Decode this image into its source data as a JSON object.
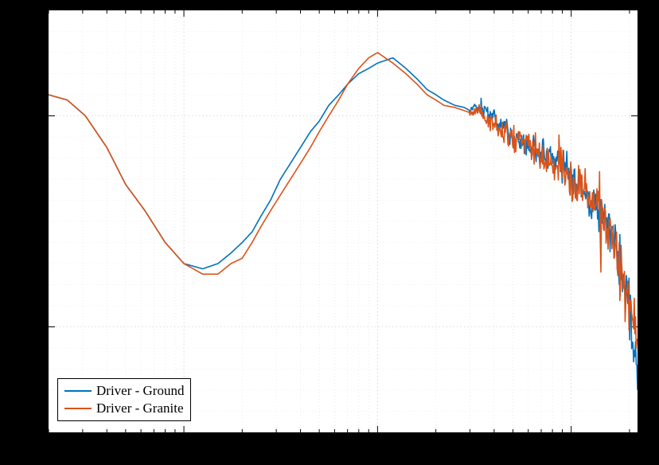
{
  "chart_data": {
    "type": "line",
    "title": "",
    "xlabel": "",
    "ylabel": "",
    "x_scale": "log",
    "x_range": [
      20,
      22000
    ],
    "y_range": [
      -30,
      10
    ],
    "major_y": [
      -20,
      0
    ],
    "series": [
      {
        "name": "Driver - Ground",
        "color": "#0072BD",
        "x": [
          20,
          25,
          31,
          40,
          50,
          63,
          80,
          100,
          125,
          150,
          175,
          200,
          225,
          250,
          280,
          315,
          355,
          400,
          450,
          500,
          560,
          630,
          700,
          800,
          900,
          1000,
          1200,
          1400,
          1600,
          1800,
          2000,
          2200,
          2500,
          2800,
          3000,
          3200,
          3500,
          4000,
          4500,
          5000,
          5600,
          6300,
          7100,
          8000,
          9000,
          10000,
          11000,
          12000,
          13000,
          14000,
          15000,
          16000,
          17000,
          18000,
          19000,
          20000,
          21000,
          22000
        ],
        "y": [
          2,
          1.5,
          0,
          -3,
          -6.5,
          -9,
          -12,
          -14,
          -14.5,
          -14,
          -13,
          -12,
          -11,
          -9.5,
          -8,
          -6,
          -4.5,
          -3,
          -1.5,
          -0.5,
          1,
          2,
          3,
          4,
          4.5,
          5,
          5.5,
          4.5,
          3.5,
          2.5,
          2,
          1.5,
          1,
          0.8,
          0.5,
          1,
          0.5,
          0,
          -1,
          -2,
          -2.5,
          -3,
          -3.5,
          -4,
          -5,
          -6,
          -6.5,
          -7.5,
          -8,
          -9,
          -10,
          -11,
          -12,
          -14,
          -16,
          -19,
          -22,
          -25
        ]
      },
      {
        "name": "Driver - Granite",
        "color": "#D95319",
        "x": [
          20,
          25,
          31,
          40,
          50,
          63,
          80,
          100,
          125,
          150,
          175,
          200,
          225,
          250,
          280,
          315,
          355,
          400,
          450,
          500,
          560,
          630,
          700,
          800,
          900,
          1000,
          1200,
          1400,
          1600,
          1800,
          2000,
          2200,
          2500,
          2800,
          3000,
          3200,
          3500,
          4000,
          4500,
          5000,
          5600,
          6300,
          7100,
          8000,
          9000,
          10000,
          11000,
          12000,
          13000,
          14000,
          15000,
          16000,
          17000,
          18000,
          19000,
          20000,
          21000,
          22000
        ],
        "y": [
          2,
          1.5,
          0,
          -3,
          -6.5,
          -9,
          -12,
          -14,
          -15,
          -15,
          -14,
          -13.5,
          -12,
          -10.5,
          -9,
          -7.5,
          -6,
          -4.5,
          -3,
          -1.5,
          0,
          1.5,
          3,
          4.5,
          5.5,
          6,
          5,
          4,
          3,
          2,
          1.5,
          1,
          0.8,
          0.5,
          0.3,
          0.5,
          0,
          -0.5,
          -1.5,
          -2,
          -2.5,
          -3,
          -3.5,
          -4.5,
          -5.5,
          -6,
          -7,
          -7.5,
          -8.5,
          -9.5,
          -10.5,
          -11.5,
          -13,
          -14.5,
          -16.5,
          -18,
          -19.5,
          -20
        ]
      }
    ],
    "noise_series": [
      {
        "name": "Driver - Ground",
        "start_x": 3000,
        "amplitude_base": 0.8,
        "amplitude_growth": 2.5
      },
      {
        "name": "Driver - Granite",
        "start_x": 3000,
        "amplitude_base": 1.0,
        "amplitude_growth": 3.2
      }
    ],
    "legend": {
      "position": "lower-left",
      "entries": [
        {
          "label": "Driver - Ground",
          "color": "#0072BD"
        },
        {
          "label": "Driver - Granite",
          "color": "#D95319"
        }
      ]
    }
  }
}
